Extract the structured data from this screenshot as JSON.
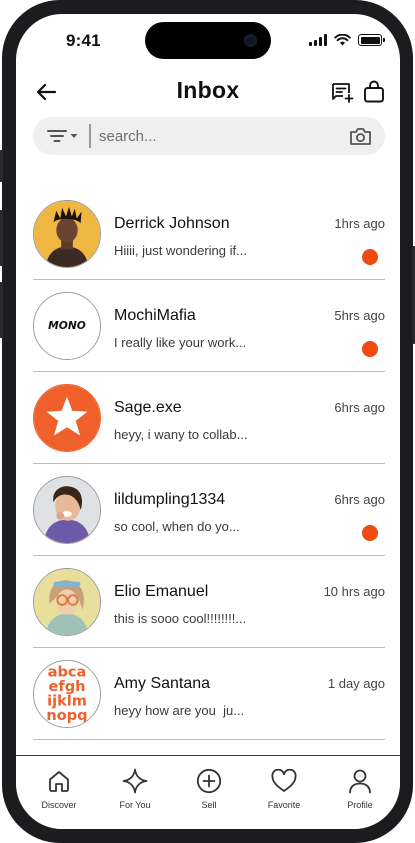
{
  "status_bar": {
    "time": "9:41"
  },
  "header": {
    "title": "Inbox"
  },
  "search": {
    "placeholder": "search..."
  },
  "colors": {
    "accent": "#ee4a12",
    "divider": "#bdbdbd",
    "search_bg": "#efefef"
  },
  "icons": {
    "back": "arrow-left-icon",
    "compose": "compose-message-icon",
    "bag": "shopping-bag-icon",
    "filter": "filter-icon",
    "camera": "camera-icon"
  },
  "messages": [
    {
      "name": "Derrick Johnson",
      "preview": "Hiiii, just wondering if...",
      "time": "1hrs ago",
      "unread": true
    },
    {
      "name": "MochiMafia",
      "preview": "I really like your work...",
      "time": "5hrs ago",
      "unread": true,
      "avatar_text": "MONO"
    },
    {
      "name": "Sage.exe",
      "preview": "heyy, i wany to collab...",
      "time": "6hrs ago",
      "unread": false
    },
    {
      "name": "lildumpling1334",
      "preview": "so cool, when do yo...",
      "time": "6hrs ago",
      "unread": true
    },
    {
      "name": "Elio Emanuel",
      "preview": "this is sooo cool!!!!!!!!...",
      "time": "10 hrs ago",
      "unread": false
    },
    {
      "name": "Amy Santana",
      "preview": "heyy how are you  ju...",
      "time": "1 day ago",
      "unread": false,
      "avatar_text": [
        "abca",
        "efgh",
        "ijklm",
        "nopq"
      ]
    }
  ],
  "tabbar": {
    "tabs": [
      {
        "label": "Discover",
        "icon": "home-icon"
      },
      {
        "label": "For You",
        "icon": "sparkle-icon"
      },
      {
        "label": "Sell",
        "icon": "plus-circle-icon"
      },
      {
        "label": "Favorite",
        "icon": "heart-icon"
      },
      {
        "label": "Profile",
        "icon": "person-icon"
      }
    ]
  }
}
